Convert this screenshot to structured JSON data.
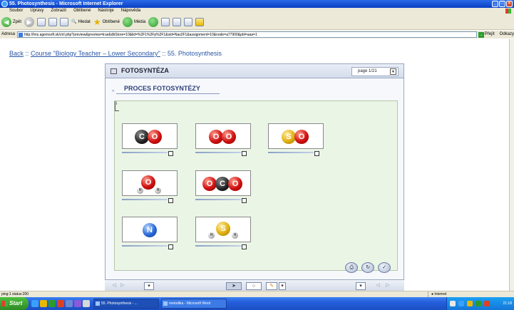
{
  "window": {
    "title": "55. Photosynthesis - Microsoft Internet Explorer"
  },
  "menu": [
    "Soubor",
    "Úpravy",
    "Zobrazit",
    "Oblíbené",
    "Nástroje",
    "Nápověda"
  ],
  "toolbar": {
    "back_label": "Zpět",
    "search_label": "Hledat",
    "favorites_label": "Oblíbené",
    "media_label": "Média"
  },
  "address": {
    "label": "Adresa",
    "url": "http://lms.agemsoft.sk/ctrl.php?preview&preview=true&dbStore=10&lid=%2F1%2Fp%2F1&sid=Nas2F1&assignment=10&node=a77900&pbl=aaa=1",
    "go_label": "Přejít",
    "links_label": "Odkazy"
  },
  "breadcrumb": {
    "back": "Back",
    "sep1": " :: ",
    "course": "Course \"Biology Teacher – Lower Secondary\"",
    "sep2": " :: ",
    "current": "55. Photosynthesis"
  },
  "panel": {
    "title": "FOTOSYNTÉZA",
    "page_indicator": "page 1/21",
    "section_title": "PROCES FOTOSYNTÉZY",
    "section_marker": "»"
  },
  "molecules": [
    {
      "id": "co2",
      "atoms": [
        "C",
        "O"
      ]
    },
    {
      "id": "o2",
      "atoms": [
        "O",
        "O"
      ]
    },
    {
      "id": "so2",
      "atoms": [
        "S",
        "O"
      ]
    },
    {
      "id": "h2o",
      "atoms": [
        "H",
        "O",
        "H"
      ]
    },
    {
      "id": "co2-full",
      "atoms": [
        "O",
        "C",
        "O"
      ]
    },
    {
      "id": "n",
      "atoms": [
        "N"
      ]
    },
    {
      "id": "h2s",
      "atoms": [
        "H",
        "S",
        "H"
      ]
    }
  ],
  "action_icons": [
    "print-icon",
    "refresh-icon",
    "check-icon"
  ],
  "status": {
    "left": "ping:1 status:200",
    "zone": "Internet"
  },
  "taskbar": {
    "start_label": "Start",
    "tasks": [
      "55. Photosynthesis - ...",
      "metodika - Microsoft Word"
    ],
    "clock": "21:18"
  },
  "colors": {
    "accent": "#2a57a8",
    "canvas_bg": "#eaf5e6",
    "oxygen": "#d01010",
    "carbon": "#1a1a1a",
    "sulfur": "#e0b010",
    "nitrogen": "#2a6ad8"
  }
}
